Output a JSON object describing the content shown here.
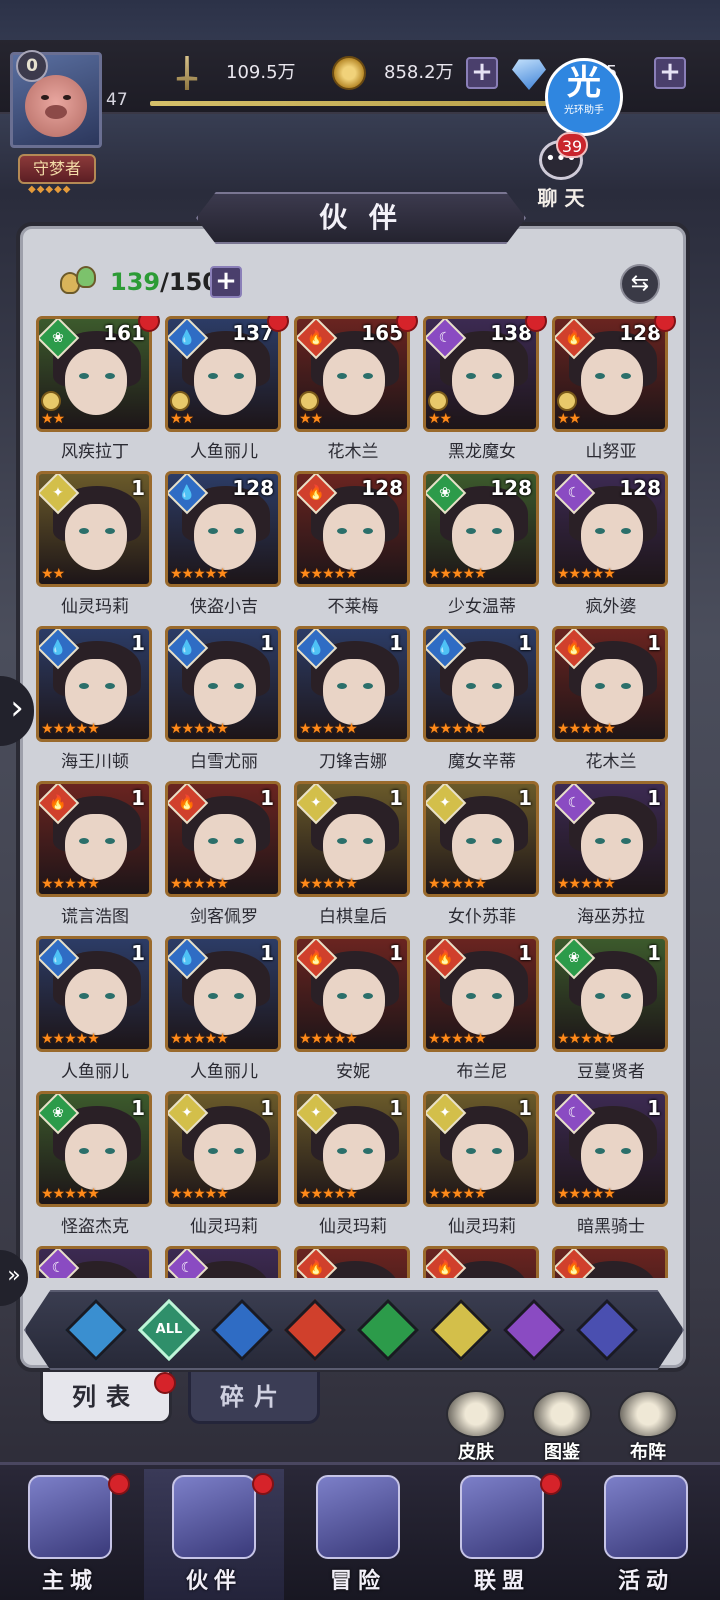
{
  "player": {
    "vip": "0",
    "title": "守梦者",
    "level": "47"
  },
  "resources": {
    "power": "109.5万",
    "gold": "858.2万",
    "gems": "5"
  },
  "helper": {
    "big": "光",
    "small": "光环助手"
  },
  "chat": {
    "label": "聊 天",
    "count": "39"
  },
  "page_title": "伙 伴",
  "capacity": {
    "current": "139",
    "max": "/150"
  },
  "heroes": [
    {
      "name": "风疾拉丁",
      "level": "161",
      "element": "nature",
      "stars": "★★",
      "dot": true,
      "rank": true
    },
    {
      "name": "人鱼丽儿",
      "level": "137",
      "element": "water",
      "stars": "★★",
      "dot": true,
      "rank": true
    },
    {
      "name": "花木兰",
      "level": "165",
      "element": "fire",
      "stars": "★★",
      "dot": true,
      "rank": true
    },
    {
      "name": "黑龙魔女",
      "level": "138",
      "element": "dark",
      "stars": "★★",
      "dot": true,
      "rank": true
    },
    {
      "name": "山努亚",
      "level": "128",
      "element": "fire",
      "stars": "★★",
      "dot": true,
      "rank": true
    },
    {
      "name": "仙灵玛莉",
      "level": "1",
      "element": "light",
      "stars": "★★",
      "dot": false,
      "rank": false
    },
    {
      "name": "侠盗小吉",
      "level": "128",
      "element": "water",
      "stars": "★★★★★",
      "dot": false,
      "rank": false
    },
    {
      "name": "不莱梅",
      "level": "128",
      "element": "fire",
      "stars": "★★★★★",
      "dot": false,
      "rank": false
    },
    {
      "name": "少女温蒂",
      "level": "128",
      "element": "nature",
      "stars": "★★★★★",
      "dot": false,
      "rank": false
    },
    {
      "name": "疯外婆",
      "level": "128",
      "element": "dark",
      "stars": "★★★★★",
      "dot": false,
      "rank": false
    },
    {
      "name": "海王川顿",
      "level": "1",
      "element": "water",
      "stars": "★★★★★",
      "dot": false,
      "rank": false
    },
    {
      "name": "白雪尤丽",
      "level": "1",
      "element": "water",
      "stars": "★★★★★",
      "dot": false,
      "rank": false
    },
    {
      "name": "刀锋吉娜",
      "level": "1",
      "element": "water",
      "stars": "★★★★★",
      "dot": false,
      "rank": false
    },
    {
      "name": "魔女辛蒂",
      "level": "1",
      "element": "water",
      "stars": "★★★★★",
      "dot": false,
      "rank": false
    },
    {
      "name": "花木兰",
      "level": "1",
      "element": "fire",
      "stars": "★★★★★",
      "dot": false,
      "rank": false
    },
    {
      "name": "谎言浩图",
      "level": "1",
      "element": "fire",
      "stars": "★★★★★",
      "dot": false,
      "rank": false
    },
    {
      "name": "剑客佩罗",
      "level": "1",
      "element": "fire",
      "stars": "★★★★★",
      "dot": false,
      "rank": false
    },
    {
      "name": "白棋皇后",
      "level": "1",
      "element": "light",
      "stars": "★★★★★",
      "dot": false,
      "rank": false
    },
    {
      "name": "女仆苏菲",
      "level": "1",
      "element": "light",
      "stars": "★★★★★",
      "dot": false,
      "rank": false
    },
    {
      "name": "海巫苏拉",
      "level": "1",
      "element": "dark",
      "stars": "★★★★★",
      "dot": false,
      "rank": false
    },
    {
      "name": "人鱼丽儿",
      "level": "1",
      "element": "water",
      "stars": "★★★★★",
      "dot": false,
      "rank": false
    },
    {
      "name": "人鱼丽儿",
      "level": "1",
      "element": "water",
      "stars": "★★★★★",
      "dot": false,
      "rank": false
    },
    {
      "name": "安妮",
      "level": "1",
      "element": "fire",
      "stars": "★★★★★",
      "dot": false,
      "rank": false
    },
    {
      "name": "布兰尼",
      "level": "1",
      "element": "fire",
      "stars": "★★★★★",
      "dot": false,
      "rank": false
    },
    {
      "name": "豆蔓贤者",
      "level": "1",
      "element": "nature",
      "stars": "★★★★★",
      "dot": false,
      "rank": false
    },
    {
      "name": "怪盗杰克",
      "level": "1",
      "element": "nature",
      "stars": "★★★★★",
      "dot": false,
      "rank": false
    },
    {
      "name": "仙灵玛莉",
      "level": "1",
      "element": "light",
      "stars": "★★★★★",
      "dot": false,
      "rank": false
    },
    {
      "name": "仙灵玛莉",
      "level": "1",
      "element": "light",
      "stars": "★★★★★",
      "dot": false,
      "rank": false
    },
    {
      "name": "仙灵玛莉",
      "level": "1",
      "element": "light",
      "stars": "★★★★★",
      "dot": false,
      "rank": false
    },
    {
      "name": "暗黑骑士",
      "level": "1",
      "element": "dark",
      "stars": "★★★★★",
      "dot": false,
      "rank": false
    },
    {
      "name": "",
      "level": "",
      "element": "dark",
      "stars": "",
      "dot": false,
      "rank": false
    },
    {
      "name": "",
      "level": "",
      "element": "dark",
      "stars": "",
      "dot": false,
      "rank": false
    },
    {
      "name": "",
      "level": "",
      "element": "fire",
      "stars": "",
      "dot": false,
      "rank": false
    },
    {
      "name": "",
      "level": "",
      "element": "fire",
      "stars": "",
      "dot": false,
      "rank": false
    },
    {
      "name": "",
      "level": "",
      "element": "fire",
      "stars": "",
      "dot": false,
      "rank": false
    }
  ],
  "filters": [
    {
      "key": "astral",
      "label": "",
      "color": "#3a8fd0"
    },
    {
      "key": "all",
      "label": "ALL",
      "color": "#2f8f6a"
    },
    {
      "key": "water",
      "label": "",
      "color": "#2f6cc4"
    },
    {
      "key": "fire",
      "label": "",
      "color": "#d0402c"
    },
    {
      "key": "nature",
      "label": "",
      "color": "#2c9b4a"
    },
    {
      "key": "light",
      "label": "",
      "color": "#d3bf4a"
    },
    {
      "key": "dark",
      "label": "",
      "color": "#8a4bc2"
    },
    {
      "key": "cosmic",
      "label": "",
      "color": "#4a4fb0"
    }
  ],
  "tabs": {
    "list": "列表",
    "shards": "碎片"
  },
  "side_buttons": {
    "skins": "皮肤",
    "codex": "图鉴",
    "formation": "布阵"
  },
  "nav": [
    {
      "label": "主城",
      "dot": true
    },
    {
      "label": "伙伴",
      "dot": true
    },
    {
      "label": "冒险",
      "dot": false
    },
    {
      "label": "联盟",
      "dot": true
    },
    {
      "label": "活动",
      "dot": false
    }
  ]
}
